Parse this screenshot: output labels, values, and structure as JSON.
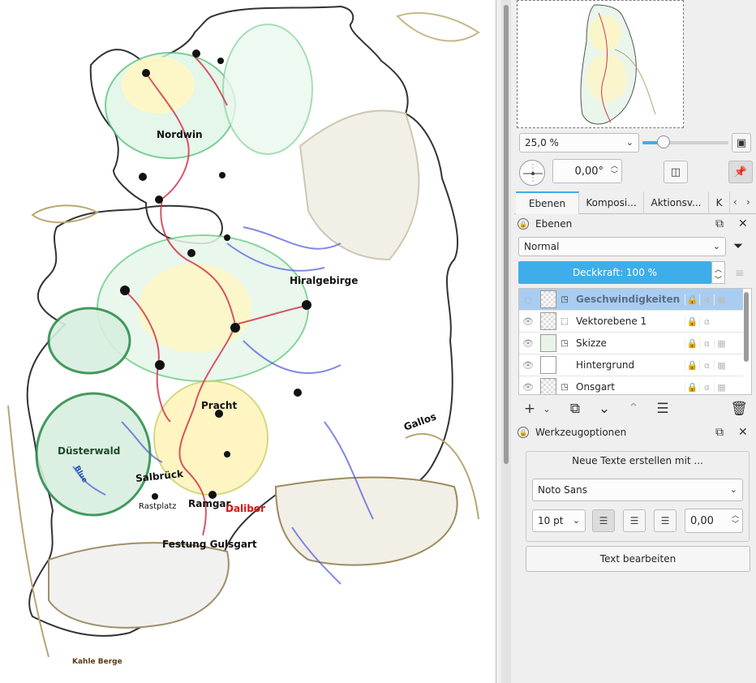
{
  "map": {
    "labels": {
      "nordwin": "Nordwin",
      "hiralgebirge": "Hiralgebirge",
      "pracht": "Pracht",
      "gallos": "Gallos",
      "duesterwald": "Düsterwald",
      "blue": "Blue",
      "salbrueck": "Salbrück",
      "rastplatz": "Rastplatz",
      "ramgar": "Ramgar",
      "dalibor": "Dalibor",
      "festung": "Festung Gulsgart",
      "kahle_berge": "Kahle Berge"
    }
  },
  "navigator": {
    "zoom_value": "25,0 %",
    "zoom_fraction": 0.2,
    "rotation_value": "0,00°"
  },
  "tabs": [
    {
      "label": "Ebenen"
    },
    {
      "label": "Komposi..."
    },
    {
      "label": "Aktionsv..."
    },
    {
      "label": "K"
    }
  ],
  "layers_docker": {
    "title": "Ebenen",
    "blend_mode": "Normal",
    "opacity_label": "Deckkraft:  100 %",
    "layers": [
      {
        "name": "Geschwindigkeiten",
        "selected": true
      },
      {
        "name": "Vektorebene 1",
        "selected": false
      },
      {
        "name": "Skizze",
        "selected": false
      },
      {
        "name": "Hintergrund",
        "selected": false
      },
      {
        "name": "Onsgart",
        "selected": false
      }
    ]
  },
  "tool_options": {
    "title": "Werkzeugoptionen",
    "create_text_caption": "Neue Texte erstellen mit ...",
    "font": "Noto Sans",
    "font_size": "10 pt",
    "letter_spacing": "0,00",
    "edit_text_label": "Text bearbeiten"
  }
}
